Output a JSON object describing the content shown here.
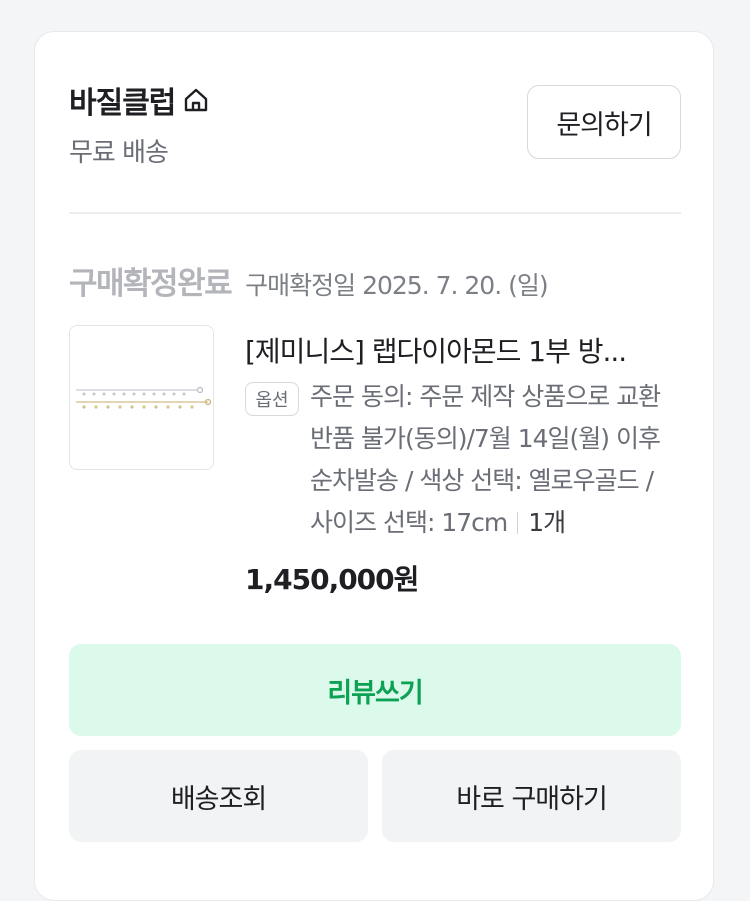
{
  "store": {
    "name": "바질클럽",
    "shipping": "무료 배송",
    "inquiry_label": "문의하기"
  },
  "order": {
    "status": "구매확정완료",
    "confirm_date": "구매확정일 2025. 7. 20. (일)"
  },
  "product": {
    "name": "[제미니스] 랩다이아몬드 1부 방...",
    "option_badge": "옵션",
    "option_text": "주문 동의: 주문 제작 상품으로 교환 반품 불가(동의)/7월 14일(월) 이후 순차발송 / 색상 선택: 옐로우골드 / 사이즈 선택: 17cm",
    "quantity": "1개",
    "price": "1,450,000원"
  },
  "actions": {
    "review_label": "리뷰쓰기",
    "track_label": "배송조회",
    "buy_again_label": "바로 구매하기"
  },
  "colors": {
    "review_bg": "#dcfaeb",
    "review_text": "#0ca153",
    "status_text": "#b3b5bb"
  }
}
